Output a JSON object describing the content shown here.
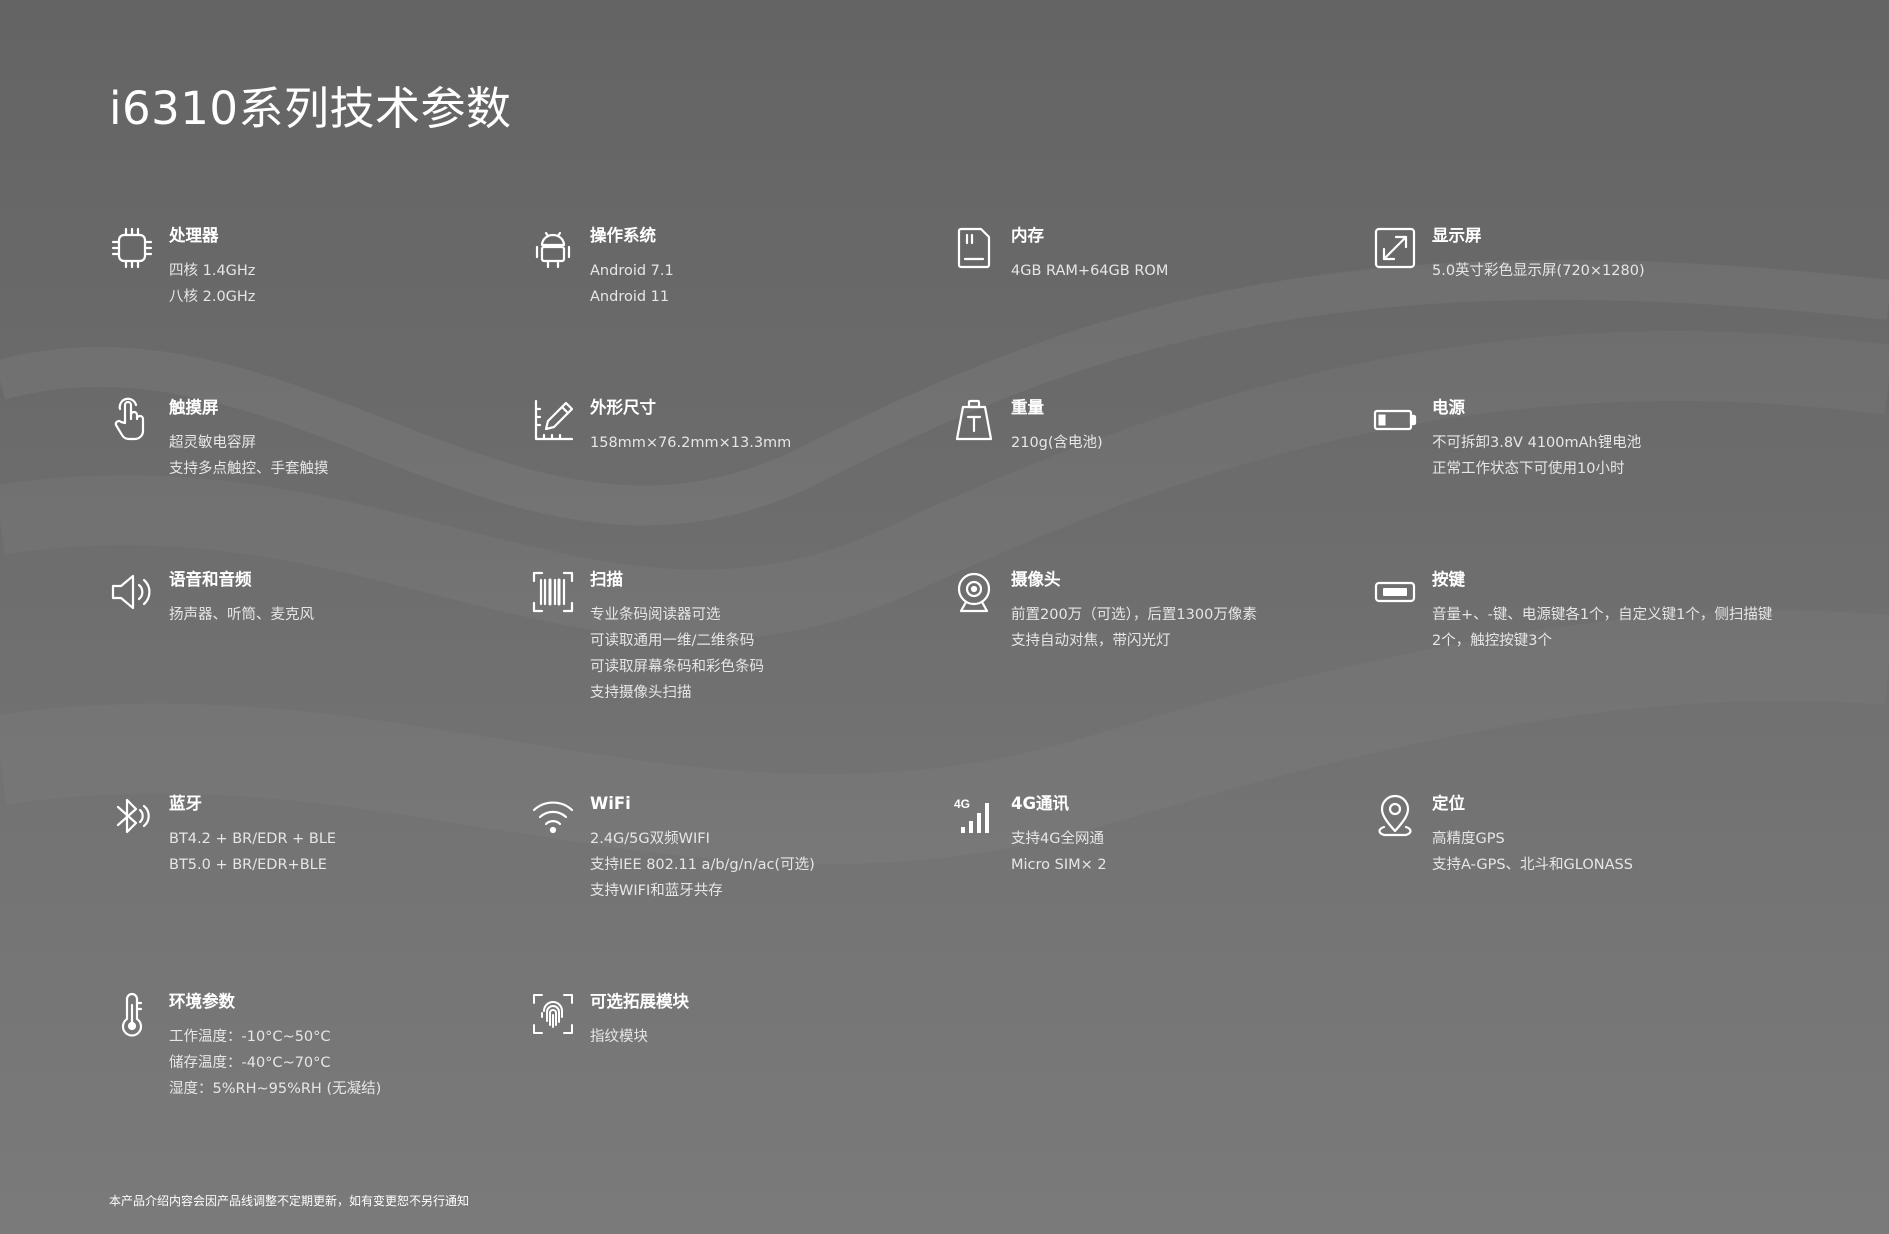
{
  "title": "i6310系列技术参数",
  "specs": [
    {
      "title": "处理器",
      "icon": "cpu-chip-icon",
      "lines": [
        "四核 1.4GHz",
        "八核 2.0GHz"
      ]
    },
    {
      "title": "操作系统",
      "icon": "android-icon",
      "lines": [
        "Android 7.1",
        "Android 11"
      ]
    },
    {
      "title": "内存",
      "icon": "sd-card-icon",
      "lines": [
        "4GB RAM+64GB ROM"
      ]
    },
    {
      "title": "显示屏",
      "icon": "expand-screen-icon",
      "lines": [
        "5.0英寸彩色显示屏(720×1280)"
      ]
    },
    {
      "title": "触摸屏",
      "icon": "touch-hand-icon",
      "lines": [
        "超灵敏电容屏",
        "支持多点触控、手套触摸"
      ]
    },
    {
      "title": "外形尺寸",
      "icon": "ruler-pencil-icon",
      "lines": [
        "158mm×76.2mm×13.3mm"
      ]
    },
    {
      "title": "重量",
      "icon": "weight-icon",
      "lines": [
        "210g(含电池)"
      ]
    },
    {
      "title": "电源",
      "icon": "battery-icon",
      "lines": [
        "不可拆卸3.8V 4100mAh锂电池",
        "正常工作状态下可使用10小时"
      ]
    },
    {
      "title": "语音和音频",
      "icon": "speaker-icon",
      "lines": [
        "扬声器、听筒、麦克风"
      ]
    },
    {
      "title": "扫描",
      "icon": "barcode-scan-icon",
      "lines": [
        "专业条码阅读器可选",
        "可读取通用一维/二维条码",
        "可读取屏幕条码和彩色条码",
        "支持摄像头扫描"
      ]
    },
    {
      "title": "摄像头",
      "icon": "webcam-icon",
      "lines": [
        "前置200万（可选），后置1300万像素",
        "支持自动对焦，带闪光灯"
      ]
    },
    {
      "title": "按键",
      "icon": "key-button-icon",
      "lines": [
        "音量+、-键、电源键各1个，自定义键1个，侧扫描键2个，触控按键3个"
      ]
    },
    {
      "title": "蓝牙",
      "icon": "bluetooth-icon",
      "lines": [
        "BT4.2 + BR/EDR + BLE",
        "BT5.0 + BR/EDR+BLE"
      ]
    },
    {
      "title": "WiFi",
      "icon": "wifi-icon",
      "lines": [
        "2.4G/5G双频WIFI",
        "支持IEE 802.11 a/b/g/n/ac(可选)",
        "支持WIFI和蓝牙共存"
      ]
    },
    {
      "title": "4G通讯",
      "icon": "signal-4g-icon",
      "icon_label": "4G",
      "lines": [
        "支持4G全网通",
        "Micro SIM× 2"
      ]
    },
    {
      "title": "定位",
      "icon": "location-pin-icon",
      "lines": [
        "高精度GPS",
        "支持A-GPS、北斗和GLONASS"
      ]
    },
    {
      "title": "环境参数",
      "icon": "thermometer-icon",
      "lines": [
        "工作温度：-10°C~50°C",
        "储存温度：-40°C~70°C",
        "湿度：5%RH~95%RH (无凝结)"
      ]
    },
    {
      "title": "可选拓展模块",
      "icon": "fingerprint-icon",
      "lines": [
        "指纹模块"
      ]
    }
  ],
  "footnote": "本产品介绍内容会因产品线调整不定期更新，如有变更恕不另行通知",
  "colors": {
    "background": "#6b6b6b",
    "text": "#ffffff",
    "subtext": "#e6e6e6"
  }
}
